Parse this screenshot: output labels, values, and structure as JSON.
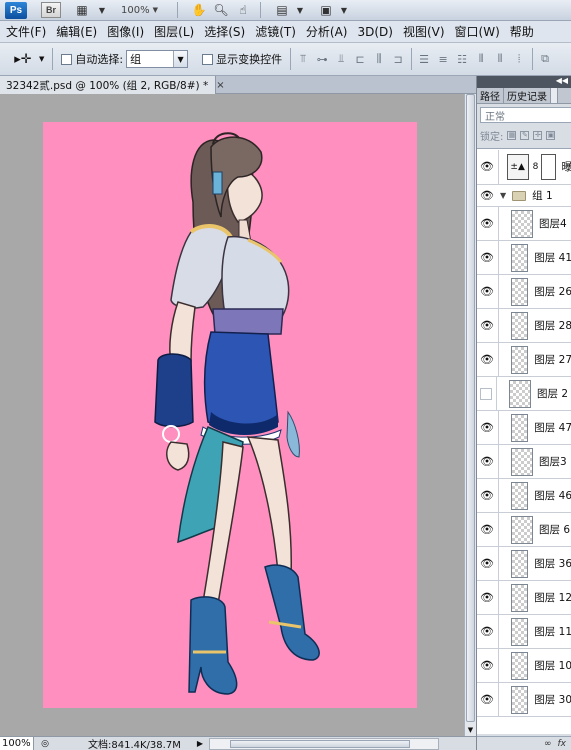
{
  "appbar": {
    "logo": "Ps",
    "bridge": "Br",
    "zoom": "100%",
    "icons": [
      "film-icon",
      "hand-icon",
      "zoom-icon",
      "rotate-view-icon",
      "arrange-icon",
      "screen-mode-icon"
    ]
  },
  "menus": [
    "文件(F)",
    "编辑(E)",
    "图像(I)",
    "图层(L)",
    "选择(S)",
    "滤镜(T)",
    "分析(A)",
    "3D(D)",
    "视图(V)",
    "窗口(W)",
    "帮助"
  ],
  "options": {
    "auto_select_label": "自动选择:",
    "auto_select_value": "组",
    "show_transform_label": "显示变换控件"
  },
  "document": {
    "tab_title": "32342贰.psd @ 100% (组 2, RGB/8#) *",
    "close": "×"
  },
  "status": {
    "zoom": "100%",
    "doc_info": "文档:841.4K/38.7M"
  },
  "panel": {
    "tabs": [
      "路径",
      "历史记录",
      ""
    ],
    "blend_mode": "正常",
    "lock_label": "锁定:",
    "adjustment_layer_name": "曝",
    "group_name": "组 1",
    "layers": [
      {
        "name": "图层4",
        "visible": true
      },
      {
        "name": "图层 41",
        "visible": true
      },
      {
        "name": "图层 26",
        "visible": true
      },
      {
        "name": "图层 28",
        "visible": true
      },
      {
        "name": "图层 27",
        "visible": true
      },
      {
        "name": "图层 2",
        "visible": false
      },
      {
        "name": "图层 47",
        "visible": true
      },
      {
        "name": "图层3",
        "visible": true
      },
      {
        "name": "图层 46",
        "visible": true
      },
      {
        "name": "图层 6",
        "visible": true
      },
      {
        "name": "图层 36",
        "visible": true
      },
      {
        "name": "图层 12",
        "visible": true
      },
      {
        "name": "图层 11",
        "visible": true
      },
      {
        "name": "图层 10",
        "visible": true
      },
      {
        "name": "图层 30",
        "visible": true
      }
    ]
  },
  "colors": {
    "canvas_bg": "#ff8fbe",
    "workspace": "#a8a8a8"
  }
}
